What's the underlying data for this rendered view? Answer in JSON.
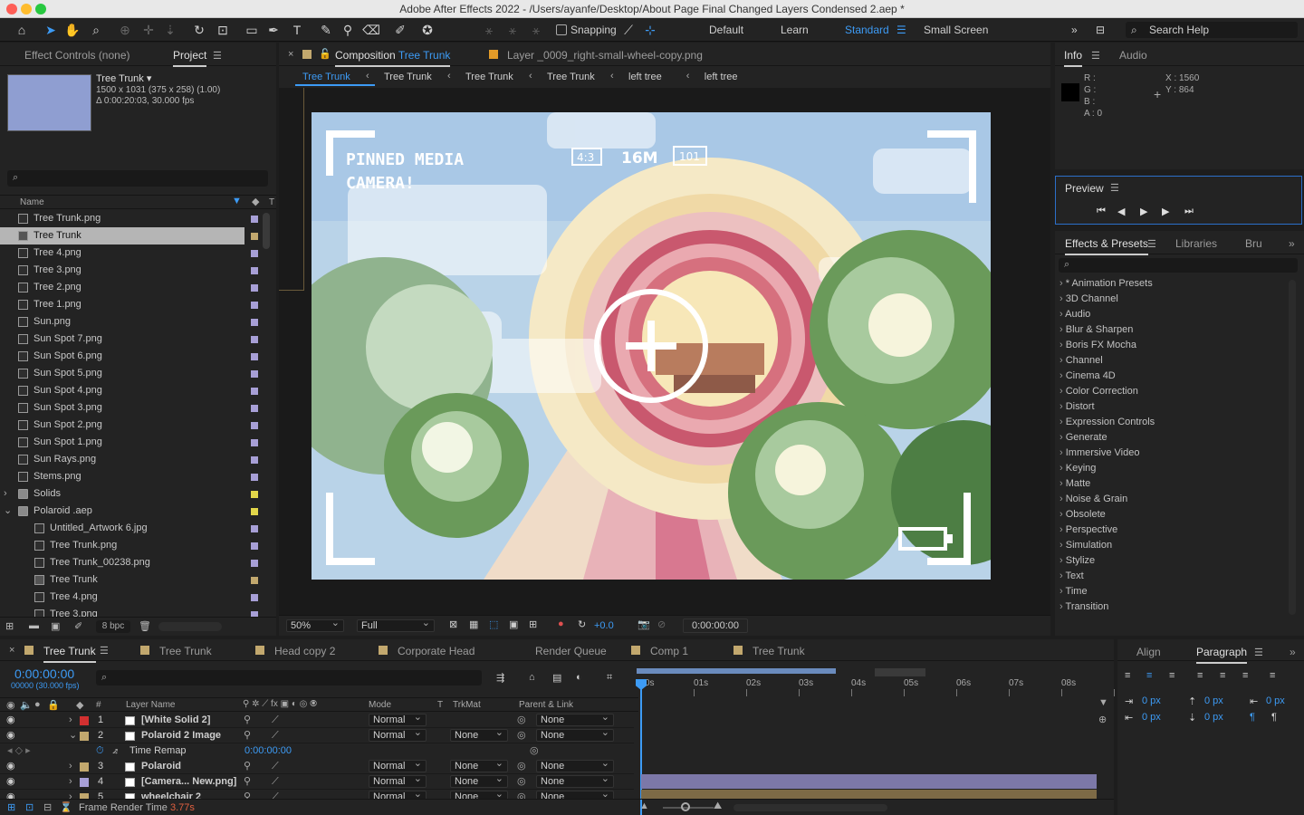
{
  "window": {
    "title": "Adobe After Effects 2022 - /Users/ayanfe/Desktop/About Page Final Changed Layers Condensed 2.aep *"
  },
  "toolbar": {
    "snapping_label": "Snapping",
    "workspaces": [
      "Default",
      "Learn",
      "Standard",
      "Small Screen"
    ],
    "active_workspace": "Standard",
    "search_placeholder": "Search Help"
  },
  "project_panel": {
    "tabs": [
      "Effect Controls (none)",
      "Project"
    ],
    "selected_name": "Tree Trunk ▾",
    "selected_dims": "1500 x 1031  (375 x 258) (1.00)",
    "selected_duration": "Δ 0:00:20:03, 30.000 fps",
    "column_name": "Name",
    "items": [
      {
        "name": "Tree Trunk.png",
        "indent": 0,
        "type": "file",
        "color": "#a79fd6"
      },
      {
        "name": "Tree Trunk",
        "indent": 0,
        "type": "comp",
        "color": "#c2a86e",
        "selected": true
      },
      {
        "name": "Tree 4.png",
        "indent": 0,
        "type": "file",
        "color": "#a79fd6"
      },
      {
        "name": "Tree 3.png",
        "indent": 0,
        "type": "file",
        "color": "#a79fd6"
      },
      {
        "name": "Tree 2.png",
        "indent": 0,
        "type": "file",
        "color": "#a79fd6"
      },
      {
        "name": "Tree 1.png",
        "indent": 0,
        "type": "file",
        "color": "#a79fd6"
      },
      {
        "name": "Sun.png",
        "indent": 0,
        "type": "file",
        "color": "#a79fd6"
      },
      {
        "name": "Sun Spot 7.png",
        "indent": 0,
        "type": "file",
        "color": "#a79fd6"
      },
      {
        "name": "Sun Spot 6.png",
        "indent": 0,
        "type": "file",
        "color": "#a79fd6"
      },
      {
        "name": "Sun Spot 5.png",
        "indent": 0,
        "type": "file",
        "color": "#a79fd6"
      },
      {
        "name": "Sun Spot 4.png",
        "indent": 0,
        "type": "file",
        "color": "#a79fd6"
      },
      {
        "name": "Sun Spot 3.png",
        "indent": 0,
        "type": "file",
        "color": "#a79fd6"
      },
      {
        "name": "Sun Spot 2.png",
        "indent": 0,
        "type": "file",
        "color": "#a79fd6"
      },
      {
        "name": "Sun Spot 1.png",
        "indent": 0,
        "type": "file",
        "color": "#a79fd6"
      },
      {
        "name": "Sun Rays.png",
        "indent": 0,
        "type": "file",
        "color": "#a79fd6"
      },
      {
        "name": "Stems.png",
        "indent": 0,
        "type": "file",
        "color": "#a79fd6"
      },
      {
        "name": "Solids",
        "indent": 0,
        "type": "folder",
        "color": "#e2d64a"
      },
      {
        "name": "Polaroid .aep",
        "indent": 0,
        "type": "folder-open",
        "color": "#e2d64a"
      },
      {
        "name": "Untitled_Artwork 6.jpg",
        "indent": 1,
        "type": "file",
        "color": "#a79fd6"
      },
      {
        "name": "Tree Trunk.png",
        "indent": 1,
        "type": "file",
        "color": "#a79fd6"
      },
      {
        "name": "Tree Trunk_00238.png",
        "indent": 1,
        "type": "file",
        "color": "#a79fd6"
      },
      {
        "name": "Tree Trunk",
        "indent": 1,
        "type": "comp",
        "color": "#c2a86e"
      },
      {
        "name": "Tree 4.png",
        "indent": 1,
        "type": "file",
        "color": "#a79fd6"
      },
      {
        "name": "Tree 3.png",
        "indent": 1,
        "type": "file",
        "color": "#a79fd6"
      }
    ],
    "bpc": "8 bpc"
  },
  "comp_panel": {
    "tab_label": "Composition",
    "tab_comp": "Tree Trunk",
    "layer_tab": "Layer _0009_right-small-wheel-copy.png",
    "breadcrumbs": [
      "Tree Trunk",
      "Tree Trunk",
      "Tree Trunk",
      "Tree Trunk",
      "left tree",
      "left tree"
    ],
    "art_text_1": "PINNED MEDIA",
    "art_text_2": "CAMERA!",
    "art_badge_ratio": "4:3",
    "art_badge_mp": "16M",
    "art_badge_count": "101",
    "zoom": "50%",
    "resolution": "Full",
    "exposure": "+0.0",
    "timecode": "0:00:00:00"
  },
  "info_panel": {
    "tabs": [
      "Info",
      "Audio"
    ],
    "r": "R :",
    "g": "G :",
    "b": "B :",
    "a": "A :  0",
    "x": "X : 1560",
    "y": "Y : 864"
  },
  "preview_panel": {
    "title": "Preview"
  },
  "effects_panel": {
    "tabs": [
      "Effects & Presets",
      "Libraries",
      "Bru"
    ],
    "categories": [
      "* Animation Presets",
      "3D Channel",
      "Audio",
      "Blur & Sharpen",
      "Boris FX Mocha",
      "Channel",
      "Cinema 4D",
      "Color Correction",
      "Distort",
      "Expression Controls",
      "Generate",
      "Immersive Video",
      "Keying",
      "Matte",
      "Noise & Grain",
      "Obsolete",
      "Perspective",
      "Simulation",
      "Stylize",
      "Text",
      "Time",
      "Transition"
    ]
  },
  "timeline": {
    "tabs": [
      "Tree Trunk",
      "Tree Trunk",
      "Head copy 2",
      "Corporate Head",
      "Render Queue",
      "Comp 1",
      "Tree Trunk"
    ],
    "tab_colors": [
      "#c2a86e",
      "#c2a86e",
      "#c2a86e",
      "#c2a86e",
      "",
      "#c2a86e",
      "#c2a86e"
    ],
    "timecode": "0:00:00:00",
    "frame_info": "00000 (30.000 fps)",
    "col_layer_name": "Layer Name",
    "col_mode": "Mode",
    "col_t": "T",
    "col_trkmat": "TrkMat",
    "col_parent": "Parent & Link",
    "ruler": [
      "0s",
      "01s",
      "02s",
      "03s",
      "04s",
      "05s",
      "06s",
      "07s",
      "08s"
    ],
    "layers": [
      {
        "num": "1",
        "name": "[White Solid 2]",
        "color": "#d23030",
        "mode": "Normal",
        "trkmat": "",
        "parent": "None",
        "expanded": false
      },
      {
        "num": "2",
        "name": "Polaroid 2 Image",
        "color": "#c2a86e",
        "mode": "Normal",
        "trkmat": "None",
        "parent": "None",
        "expanded": true
      },
      {
        "num": "3",
        "name": "Polaroid",
        "color": "#c2a86e",
        "mode": "Normal",
        "trkmat": "None",
        "parent": "None",
        "expanded": false
      },
      {
        "num": "4",
        "name": "[Camera... New.png]",
        "color": "#a79fd6",
        "mode": "Normal",
        "trkmat": "None",
        "parent": "None",
        "expanded": false
      },
      {
        "num": "5",
        "name": "wheelchair 2",
        "color": "#c2a86e",
        "mode": "Normal",
        "trkmat": "None",
        "parent": "None",
        "expanded": false
      }
    ],
    "time_remap_label": "Time Remap",
    "time_remap_value": "0:00:00:00",
    "render_time_label": "Frame Render Time",
    "render_time_value": "3.77s"
  },
  "paragraph_panel": {
    "tabs": [
      "Align",
      "Paragraph"
    ],
    "values": [
      "0 px",
      "0 px",
      "0 px",
      "0 px",
      "0 px"
    ]
  }
}
